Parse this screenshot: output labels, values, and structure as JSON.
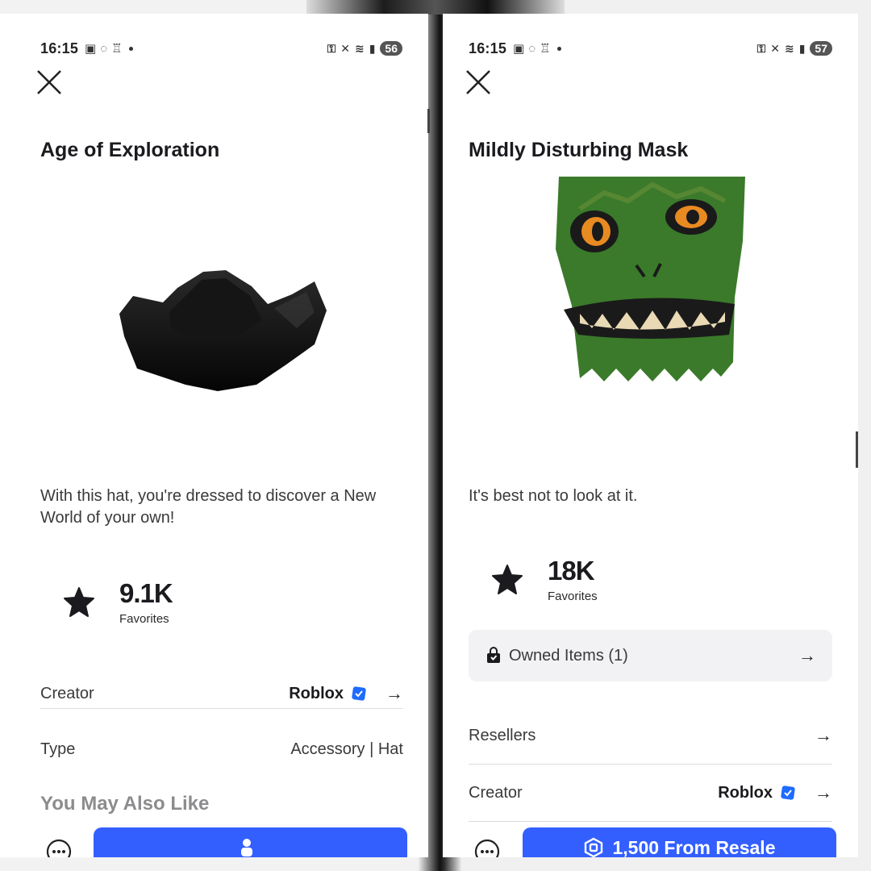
{
  "panels": [
    {
      "status": {
        "time": "16:15",
        "battery": "56"
      },
      "title": "Age of Exploration",
      "description": "With this hat, you're dressed to discover a New World of your own!",
      "favorites": {
        "count": "9.1K",
        "label": "Favorites"
      },
      "creator": {
        "label": "Creator",
        "value": "Roblox"
      },
      "type": {
        "label": "Type",
        "value": "Accessory | Hat"
      },
      "section_title": "You May Also Like",
      "icons": [
        "close-icon",
        "star-icon",
        "verified-badge-icon",
        "arrow-right-icon",
        "more-icon",
        "avatar-icon"
      ]
    },
    {
      "status": {
        "time": "16:15",
        "battery": "57"
      },
      "title": "Mildly Disturbing Mask",
      "description": "It's best not to look at it.",
      "favorites": {
        "count": "18K",
        "label": "Favorites"
      },
      "owned": {
        "label": "Owned Items (1)"
      },
      "resellers": {
        "label": "Resellers"
      },
      "creator": {
        "label": "Creator",
        "value": "Roblox"
      },
      "cta": {
        "label": "1,500 From Resale"
      },
      "icons": [
        "close-icon",
        "star-icon",
        "lock-bag-icon",
        "verified-badge-icon",
        "arrow-right-icon",
        "more-icon",
        "robux-icon"
      ]
    }
  ],
  "colors": {
    "primary_button": "#335fff",
    "verified": "#1e6bff",
    "text": "#1b1b1f",
    "muted": "#8c8c8e"
  }
}
